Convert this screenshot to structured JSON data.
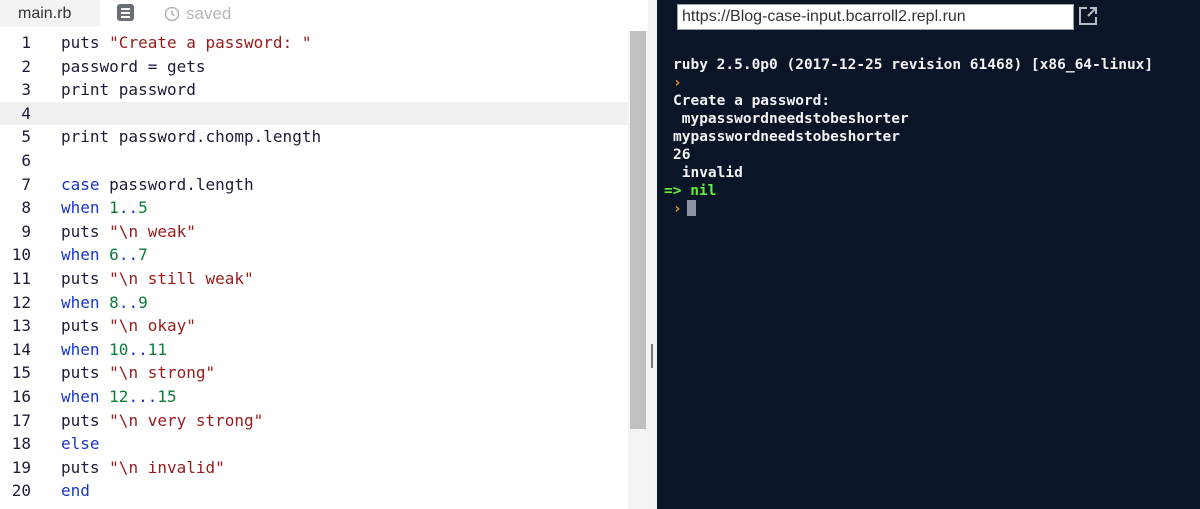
{
  "editor": {
    "file_tab": "main.rb",
    "saved_label": "saved",
    "lines": [
      {
        "n": "1",
        "tokens": [
          {
            "t": "puts ",
            "c": "plain"
          },
          {
            "t": "\"Create a password: \"",
            "c": "str"
          }
        ]
      },
      {
        "n": "2",
        "tokens": [
          {
            "t": "password = gets",
            "c": "plain"
          }
        ]
      },
      {
        "n": "3",
        "tokens": [
          {
            "t": "print password",
            "c": "plain"
          }
        ]
      },
      {
        "n": "4",
        "tokens": []
      },
      {
        "n": "5",
        "tokens": [
          {
            "t": "print password.chomp.length",
            "c": "plain"
          }
        ]
      },
      {
        "n": "6",
        "tokens": []
      },
      {
        "n": "7",
        "tokens": [
          {
            "t": "case",
            "c": "kw"
          },
          {
            "t": " password.length",
            "c": "plain"
          }
        ]
      },
      {
        "n": "8",
        "tokens": [
          {
            "t": "when",
            "c": "kw"
          },
          {
            "t": " ",
            "c": "plain"
          },
          {
            "t": "1",
            "c": "num"
          },
          {
            "t": "..",
            "c": "kw"
          },
          {
            "t": "5",
            "c": "num"
          }
        ]
      },
      {
        "n": "9",
        "tokens": [
          {
            "t": "puts ",
            "c": "plain"
          },
          {
            "t": "\"\\n weak\"",
            "c": "str"
          }
        ]
      },
      {
        "n": "10",
        "tokens": [
          {
            "t": "when",
            "c": "kw"
          },
          {
            "t": " ",
            "c": "plain"
          },
          {
            "t": "6",
            "c": "num"
          },
          {
            "t": "..",
            "c": "kw"
          },
          {
            "t": "7",
            "c": "num"
          }
        ]
      },
      {
        "n": "11",
        "tokens": [
          {
            "t": "puts ",
            "c": "plain"
          },
          {
            "t": "\"\\n still weak\"",
            "c": "str"
          }
        ]
      },
      {
        "n": "12",
        "tokens": [
          {
            "t": "when",
            "c": "kw"
          },
          {
            "t": " ",
            "c": "plain"
          },
          {
            "t": "8",
            "c": "num"
          },
          {
            "t": "..",
            "c": "kw"
          },
          {
            "t": "9",
            "c": "num"
          }
        ]
      },
      {
        "n": "13",
        "tokens": [
          {
            "t": "puts ",
            "c": "plain"
          },
          {
            "t": "\"\\n okay\"",
            "c": "str"
          }
        ]
      },
      {
        "n": "14",
        "tokens": [
          {
            "t": "when",
            "c": "kw"
          },
          {
            "t": " ",
            "c": "plain"
          },
          {
            "t": "10",
            "c": "num"
          },
          {
            "t": "..",
            "c": "kw"
          },
          {
            "t": "11",
            "c": "num"
          }
        ]
      },
      {
        "n": "15",
        "tokens": [
          {
            "t": "puts ",
            "c": "plain"
          },
          {
            "t": "\"\\n strong\"",
            "c": "str"
          }
        ]
      },
      {
        "n": "16",
        "tokens": [
          {
            "t": "when",
            "c": "kw"
          },
          {
            "t": " ",
            "c": "plain"
          },
          {
            "t": "12",
            "c": "num"
          },
          {
            "t": "...",
            "c": "kw"
          },
          {
            "t": "15",
            "c": "num"
          }
        ]
      },
      {
        "n": "17",
        "tokens": [
          {
            "t": "puts ",
            "c": "plain"
          },
          {
            "t": "\"\\n very strong\"",
            "c": "str"
          }
        ]
      },
      {
        "n": "18",
        "tokens": [
          {
            "t": "else",
            "c": "kw"
          }
        ]
      },
      {
        "n": "19",
        "tokens": [
          {
            "t": "puts ",
            "c": "plain"
          },
          {
            "t": "\"\\n invalid\"",
            "c": "str"
          }
        ]
      },
      {
        "n": "20",
        "tokens": [
          {
            "t": "end",
            "c": "kw"
          }
        ]
      }
    ],
    "active_line": "4"
  },
  "console": {
    "url": "https://Blog-case-input.bcarroll2.repl.run",
    "version": "ruby 2.5.0p0 (2017-12-25 revision 61468) [x86_64-linux]",
    "prompt_symbol": "›",
    "output": [
      "Create a password:",
      " mypasswordneedstobeshorter",
      "mypasswordneedstobeshorter",
      "26",
      " invalid"
    ],
    "result": "=> nil"
  },
  "colors": {
    "keyword": "#1a35c8",
    "string": "#981a1a",
    "number": "#0e7a3a",
    "console_bg": "#0b1528",
    "prompt": "#f5a00c",
    "result": "#5ff234"
  },
  "icons": [
    "markdown-doc-icon",
    "saved-history-icon",
    "open-in-new-tab-icon"
  ]
}
